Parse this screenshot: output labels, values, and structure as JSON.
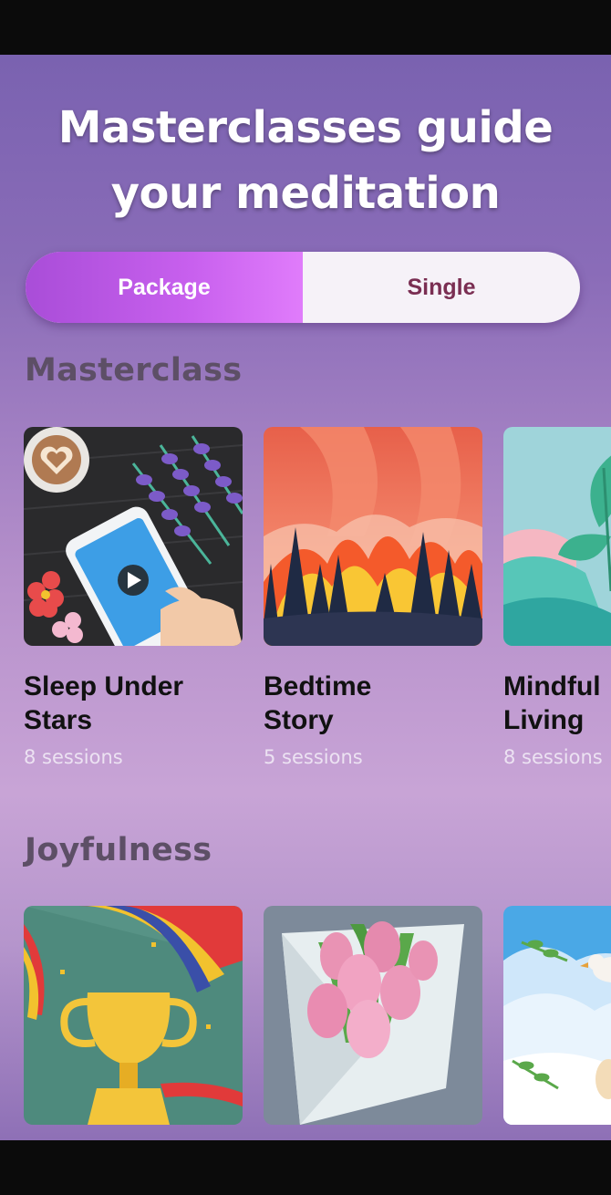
{
  "header": {
    "title": "Masterclasses guide your meditation"
  },
  "toggle": {
    "options": [
      {
        "label": "Package",
        "active": true
      },
      {
        "label": "Single",
        "active": false
      }
    ]
  },
  "sections": [
    {
      "title": "Masterclass",
      "cards": [
        {
          "title_line1": "Sleep Under",
          "title_line2": "Stars",
          "sessions": "8 sessions"
        },
        {
          "title_line1": "Bedtime",
          "title_line2": "Story",
          "sessions": "5 sessions"
        },
        {
          "title_line1": "Mindful",
          "title_line2": "Living",
          "sessions": "8 sessions"
        }
      ]
    },
    {
      "title": "Joyfulness",
      "cards": [
        {},
        {},
        {}
      ]
    }
  ],
  "colors": {
    "accent": "#c860ee",
    "inactive_text": "#7a2e52",
    "background_top": "#7a62b0"
  },
  "icons": [
    "play-icon",
    "coffee-heart-icon",
    "trophy-icon",
    "tulip-bouquet-icon",
    "dove-icon"
  ]
}
